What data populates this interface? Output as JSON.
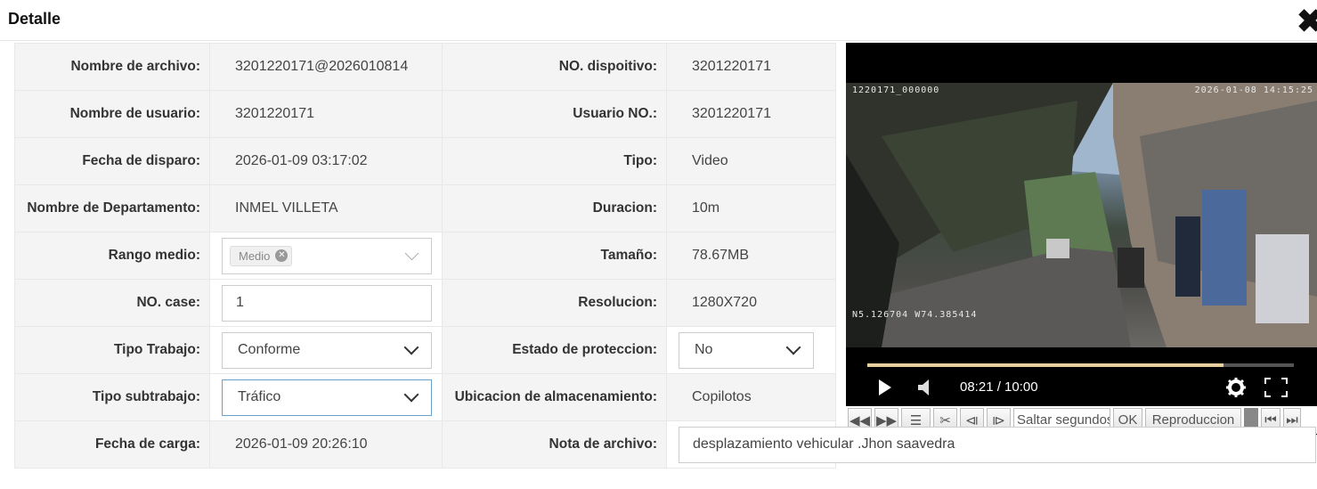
{
  "dialog": {
    "title": "Detalle",
    "close": "✖"
  },
  "rows": [
    {
      "l1": "Nombre de archivo:",
      "v1": "3201220171@2026010814",
      "l2": "NO. dispoitivo:",
      "v2": "3201220171"
    },
    {
      "l1": "Nombre de usuario:",
      "v1": "3201220171",
      "l2": "Usuario NO.:",
      "v2": "3201220171"
    },
    {
      "l1": "Fecha de disparo:",
      "v1": "2026-01-09 03:17:02",
      "l2": "Tipo:",
      "v2": "Video"
    },
    {
      "l1": "Nombre de Departamento:",
      "v1": "INMEL VILLETA",
      "l2": "Duracion:",
      "v2": "10m"
    },
    {
      "l1": "Rango medio:",
      "v1": "Medio",
      "l2": "Tamaño:",
      "v2": "78.67MB"
    },
    {
      "l1": "NO. case:",
      "v1": "1",
      "l2": "Resolucion:",
      "v2": "1280X720"
    },
    {
      "l1": "Tipo Trabajo:",
      "v1": "Conforme",
      "l2": "Estado de proteccion:",
      "v2": "No"
    },
    {
      "l1": "Tipo subtrabajo:",
      "v1": "Tráfico",
      "l2": "Ubicacion de almacenamiento:",
      "v2": "Copilotos"
    },
    {
      "l1": "Fecha de carga:",
      "v1": "2026-01-09 20:26:10",
      "l2": "Nota de archivo:",
      "v2": "desplazamiento vehicular .Jhon saavedra"
    }
  ],
  "player": {
    "osd_left": "1220171_000000",
    "osd_right": "2026-01-08 14:15:25",
    "osd_gps": "N5.126704 W74.385414",
    "time": "08:21 / 10:00",
    "progress": 0.835
  },
  "toolbar": {
    "seek_placeholder": "Saltar segundos",
    "ok": "OK",
    "reproduccion": "Reproduccion"
  }
}
